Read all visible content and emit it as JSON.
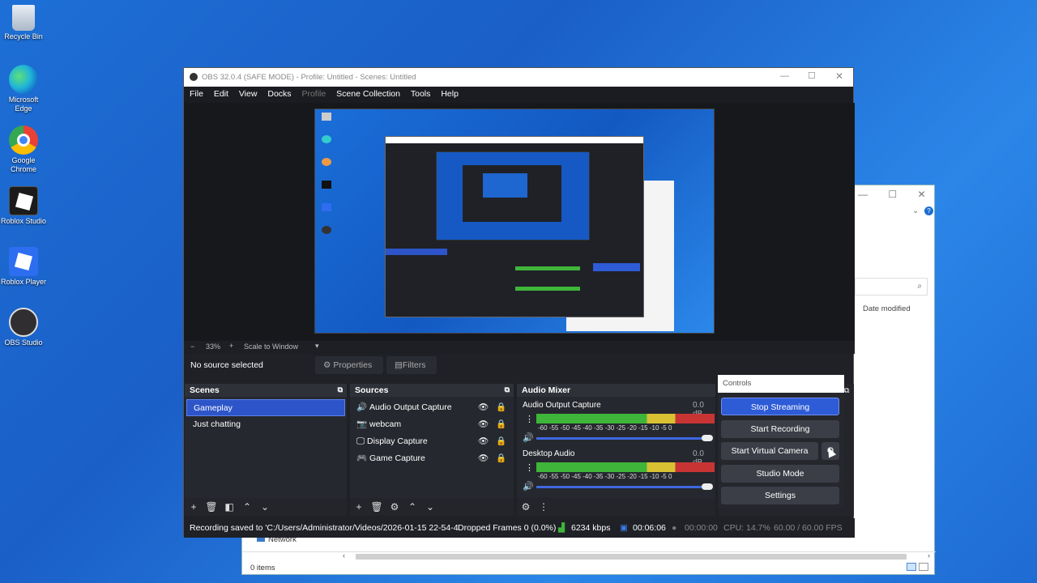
{
  "desktop": {
    "icons": [
      {
        "label": "Recycle Bin",
        "icon": "recycle-bin-icon"
      },
      {
        "label": "Microsoft Edge",
        "icon": "edge-icon"
      },
      {
        "label": "Google Chrome",
        "icon": "chrome-icon"
      },
      {
        "label": "Roblox Studio",
        "icon": "roblox-studio-icon"
      },
      {
        "label": "Roblox Player",
        "icon": "roblox-player-icon"
      },
      {
        "label": "OBS Studio",
        "icon": "obs-icon"
      }
    ]
  },
  "explorer": {
    "search_icon": "search-icon",
    "column_date": "Date modified",
    "nav_network": "Network",
    "item_count": "0 items"
  },
  "obs": {
    "title": "OBS 32.0.4 (SAFE MODE) - Profile: Untitled - Scenes: Untitled",
    "menu": [
      "File",
      "Edit",
      "View",
      "Docks",
      "Profile",
      "Scene Collection",
      "Tools",
      "Help"
    ],
    "zoom": {
      "minus": "−",
      "value": "33%",
      "plus": "+",
      "mode": "Scale to Window"
    },
    "source_bar": {
      "no_source": "No source selected",
      "properties": "Properties",
      "filters": "Filters"
    },
    "scenes": {
      "title": "Scenes",
      "items": [
        "Gameplay",
        "Just chatting"
      ],
      "selected": "Gameplay"
    },
    "sources": {
      "title": "Sources",
      "items": [
        {
          "label": "Audio Output Capture",
          "icon": "speaker-icon"
        },
        {
          "label": "webcam",
          "icon": "camera-icon"
        },
        {
          "label": "Display Capture",
          "icon": "monitor-icon"
        },
        {
          "label": "Game Capture",
          "icon": "gamepad-icon"
        }
      ]
    },
    "mixer": {
      "title": "Audio Mixer",
      "channels": [
        {
          "name": "Audio Output Capture",
          "db": "0.0 dB"
        },
        {
          "name": "Desktop Audio",
          "db": "0.0 dB"
        }
      ],
      "scale": "-60 -55 -50 -45 -40 -35 -30 -25 -20 -15 -10 -5 0"
    },
    "controls": {
      "title": "Controls",
      "stop_streaming": "Stop Streaming",
      "start_recording": "Start Recording",
      "start_virtual_camera": "Start Virtual Camera",
      "studio_mode": "Studio Mode",
      "settings": "Settings"
    },
    "status": {
      "recording_saved": "Recording saved to 'C:/Users/Administrator/Videos/2026-01-15 22-54-4",
      "dropped": "Dropped Frames 0 (0.0%)",
      "bitrate": "6234 kbps",
      "stream_time": "00:06:06",
      "rec_time": "00:00:00",
      "cpu": "CPU: 14.7%",
      "fps": "60.00 / 60.00 FPS"
    }
  },
  "colors": {
    "accent": "#2e5bd6",
    "desktop": "#1d6fd6",
    "obs_bg": "#1f2127"
  }
}
